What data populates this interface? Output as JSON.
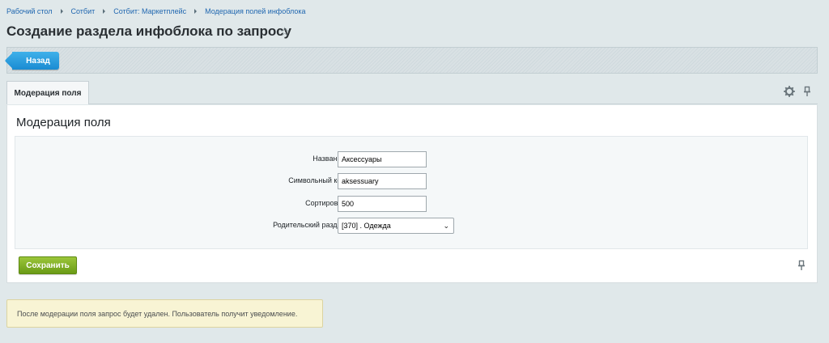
{
  "breadcrumb": [
    "Рабочий стол",
    "Сотбит",
    "Сотбит: Маркетплейс",
    "Модерация полей инфоблока"
  ],
  "page": {
    "title": "Создание раздела инфоблока по запросу"
  },
  "toolbar": {
    "back_label": "Назад"
  },
  "tabs": [
    {
      "label": "Модерация поля"
    }
  ],
  "form": {
    "section_title": "Модерация поля",
    "fields": {
      "name": {
        "label": "Название:",
        "value": "Аксессуары"
      },
      "code": {
        "label": "Символьный код:",
        "value": "aksessuary"
      },
      "sort": {
        "label": "Сортировка:",
        "value": "500"
      },
      "parent": {
        "label": "Родительский раздел:",
        "value": "[370] . Одежда"
      }
    },
    "save_label": "Сохранить"
  },
  "notice": {
    "text": "После модерации поля запрос будет удален. Пользователь получит уведомление."
  },
  "colors": {
    "accent": "#1a8bd2",
    "save": "#7aa81f",
    "link": "#2067b0"
  }
}
